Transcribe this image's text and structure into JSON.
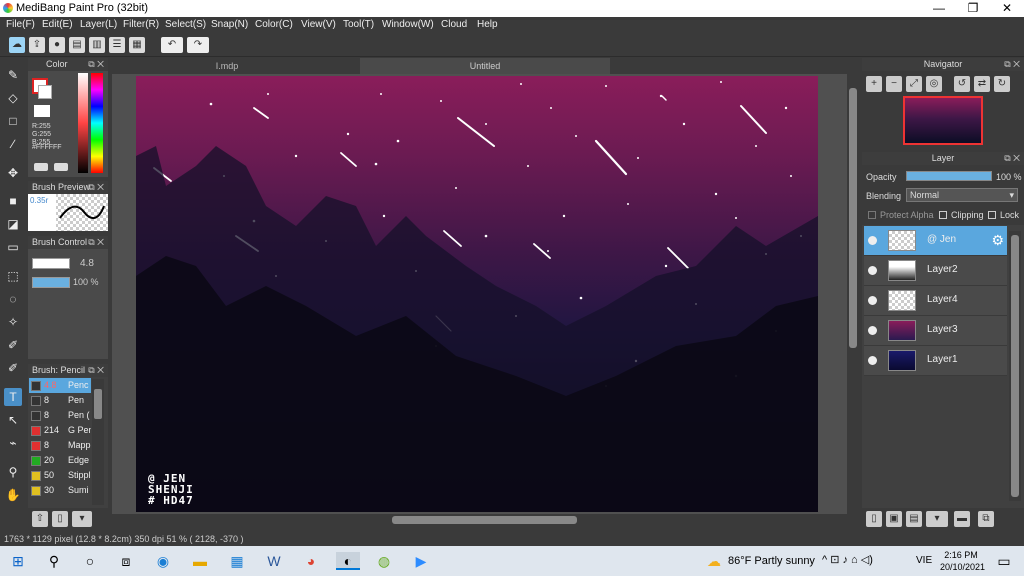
{
  "window": {
    "title": "MediBang Paint Pro (32bit)",
    "minimize": "—",
    "maximize": "❐",
    "close": "✕"
  },
  "menu": [
    "File(F)",
    "Edit(E)",
    "Layer(L)",
    "Filter(R)",
    "Select(S)",
    "Snap(N)",
    "Color(C)",
    "View(V)",
    "Tool(T)",
    "Window(W)",
    "Cloud",
    "Help"
  ],
  "tabs": {
    "file": "I.mdp",
    "untitled": "Untitled"
  },
  "color_panel": {
    "title": "Color",
    "r": "R:255",
    "g": "G:255",
    "b": "B:255",
    "hex": "#FFFFFF"
  },
  "brush_preview": {
    "title": "Brush Preview",
    "size": "0.35r"
  },
  "brush_control": {
    "title": "Brush Control",
    "size": "4.8",
    "opacity": "100 %"
  },
  "brush_list": {
    "title": "Brush: Pencil",
    "items": [
      {
        "size": "4.8",
        "name": "Penc",
        "color": "#333333"
      },
      {
        "size": "8",
        "name": "Pen",
        "color": "#333333"
      },
      {
        "size": "8",
        "name": "Pen (",
        "color": "#333333"
      },
      {
        "size": "214",
        "name": "G Pen",
        "color": "#e03030"
      },
      {
        "size": "8",
        "name": "Mappi",
        "color": "#e03030"
      },
      {
        "size": "20",
        "name": "Edge",
        "color": "#22aa22"
      },
      {
        "size": "50",
        "name": "Stippl",
        "color": "#e0c020"
      },
      {
        "size": "30",
        "name": "Sumi",
        "color": "#e0c020"
      }
    ]
  },
  "artwork": {
    "signature_line1": "@ JEN",
    "signature_line2": "SHENJI",
    "signature_line3": "# HD47"
  },
  "navigator": {
    "title": "Navigator"
  },
  "layer_panel": {
    "title": "Layer",
    "opacity_label": "Opacity",
    "opacity_value": "100 %",
    "blending_label": "Blending",
    "blending_value": "Normal",
    "protect_alpha": "Protect Alpha",
    "clipping": "Clipping",
    "lock": "Lock",
    "layers": [
      {
        "name": "@ Jen",
        "selected": true
      },
      {
        "name": "Layer2",
        "selected": false
      },
      {
        "name": "Layer4",
        "selected": false
      },
      {
        "name": "Layer3",
        "selected": false
      },
      {
        "name": "Layer1",
        "selected": false
      }
    ]
  },
  "status": "1763 * 1129 pixel  (12.8 * 8.2cm)  350 dpi  51 %  ( 2128, -370 )",
  "taskbar": {
    "weather": "86°F  Partly sunny",
    "lang": "VIE",
    "time": "2:16 PM",
    "date": "20/10/2021"
  }
}
